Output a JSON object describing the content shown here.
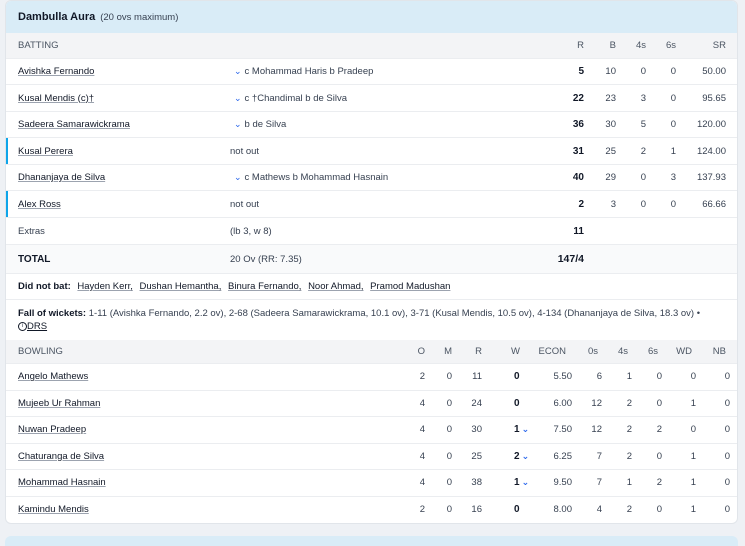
{
  "team": {
    "name": "Dambulla Aura",
    "overs_note": "(20 ovs maximum)"
  },
  "batting": {
    "headers": {
      "label": "BATTING",
      "r": "R",
      "b": "B",
      "fours": "4s",
      "sixes": "6s",
      "sr": "SR"
    },
    "rows": [
      {
        "name": "Avishka Fernando",
        "dismissal": "c Mohammad Haris b Pradeep",
        "r": "5",
        "b": "10",
        "fours": "0",
        "sixes": "0",
        "sr": "50.00"
      },
      {
        "name": "Kusal Mendis (c)†",
        "dismissal": "c †Chandimal b de Silva",
        "r": "22",
        "b": "23",
        "fours": "3",
        "sixes": "0",
        "sr": "95.65"
      },
      {
        "name": "Sadeera Samarawickrama",
        "dismissal": "b de Silva",
        "r": "36",
        "b": "30",
        "fours": "5",
        "sixes": "0",
        "sr": "120.00"
      },
      {
        "name": "Kusal Perera",
        "dismissal": "not out",
        "r": "31",
        "b": "25",
        "fours": "2",
        "sixes": "1",
        "sr": "124.00"
      },
      {
        "name": "Dhananjaya de Silva",
        "dismissal": "c Mathews b Mohammad Hasnain",
        "r": "40",
        "b": "29",
        "fours": "0",
        "sixes": "3",
        "sr": "137.93"
      },
      {
        "name": "Alex Ross",
        "dismissal": "not out",
        "r": "2",
        "b": "3",
        "fours": "0",
        "sixes": "0",
        "sr": "66.66"
      }
    ],
    "extras": {
      "label": "Extras",
      "detail": "(lb 3, w 8)",
      "value": "11"
    },
    "total": {
      "label": "TOTAL",
      "detail": "20 Ov (RR: 7.35)",
      "value": "147/4"
    }
  },
  "did_not_bat": {
    "label": "Did not bat:",
    "players": [
      "Hayden Kerr,",
      "Dushan Hemantha,",
      "Binura Fernando,",
      "Noor Ahmad,",
      "Pramod Madushan"
    ]
  },
  "fall_of_wickets": {
    "label": "Fall of wickets:",
    "text": "1-11 (Avishka Fernando, 2.2 ov), 2-68 (Sadeera Samarawickrama, 10.1 ov), 3-71 (Kusal Mendis, 10.5 ov), 4-134 (Dhananjaya de Silva, 18.3 ov) •",
    "drs": "DRS"
  },
  "bowling": {
    "headers": {
      "label": "BOWLING",
      "o": "O",
      "m": "M",
      "r": "R",
      "w": "W",
      "econ": "ECON",
      "dots": "0s",
      "fours": "4s",
      "sixes": "6s",
      "wd": "WD",
      "nb": "NB"
    },
    "rows": [
      {
        "name": "Angelo Mathews",
        "o": "2",
        "m": "0",
        "r": "11",
        "w": "0",
        "econ": "5.50",
        "dots": "6",
        "fours": "1",
        "sixes": "0",
        "wd": "0",
        "nb": "0"
      },
      {
        "name": "Mujeeb Ur Rahman",
        "o": "4",
        "m": "0",
        "r": "24",
        "w": "0",
        "econ": "6.00",
        "dots": "12",
        "fours": "2",
        "sixes": "0",
        "wd": "1",
        "nb": "0"
      },
      {
        "name": "Nuwan Pradeep",
        "o": "4",
        "m": "0",
        "r": "30",
        "w": "1",
        "econ": "7.50",
        "dots": "12",
        "fours": "2",
        "sixes": "2",
        "wd": "0",
        "nb": "0"
      },
      {
        "name": "Chaturanga de Silva",
        "o": "4",
        "m": "0",
        "r": "25",
        "w": "2",
        "econ": "6.25",
        "dots": "7",
        "fours": "2",
        "sixes": "0",
        "wd": "1",
        "nb": "0"
      },
      {
        "name": "Mohammad Hasnain",
        "o": "4",
        "m": "0",
        "r": "38",
        "w": "1",
        "econ": "9.50",
        "dots": "7",
        "fours": "1",
        "sixes": "2",
        "wd": "1",
        "nb": "0"
      },
      {
        "name": "Kamindu Mendis",
        "o": "2",
        "m": "0",
        "r": "16",
        "w": "0",
        "econ": "8.00",
        "dots": "4",
        "fours": "2",
        "sixes": "0",
        "wd": "1",
        "nb": "0"
      }
    ]
  },
  "colors": {
    "header_bg": "#d9ecf7",
    "accent": "#0ea5e9",
    "chevron": "#2563eb"
  },
  "icons": {
    "expand": "chevron-down-icon",
    "drs": "info-circle-icon"
  }
}
